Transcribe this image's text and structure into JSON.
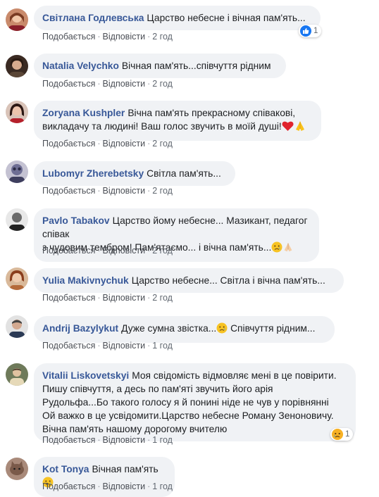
{
  "actions": {
    "like": "Подобається",
    "reply": "Відповісти",
    "sep": "·"
  },
  "comments": [
    {
      "author": "Світлана Годлевська",
      "text": "Царство небесне і вічная пам'ять...",
      "time": "2 год",
      "reaction": {
        "type": "like",
        "count": "1"
      }
    },
    {
      "author": "Natalia Velychko",
      "text": "Вічная пам'ять...співчуття рідним",
      "time": "2 год"
    },
    {
      "author": "Zoryana Kushpler",
      "line1": "Вічна пам'ять прекрасному співакові,",
      "line2": "викладачу та людині! Ваш голос звучить в моїй душі!",
      "time": "2 год",
      "emojis": [
        "red-heart",
        "folded-hands"
      ]
    },
    {
      "author": "Lubomyr Zherebetsky",
      "text": "Світла пам'ять...",
      "time": "2 год"
    },
    {
      "author": "Pavlo Tabakov",
      "line1": "Царство йому небесне... Мазикант, педагог співак",
      "line2": "з чудовим тембром! Пам'ятаємо... і вічна пам'ять...",
      "time": "2 год",
      "emojis": [
        "sad-face",
        "folded-hands"
      ]
    },
    {
      "author": "Yulia Makivnychuk",
      "text": "Царство небесне... Світла і вічна пам'ять...",
      "time": "2 год"
    },
    {
      "author": "Andrij Bazylykut",
      "text_before": "Дуже сумна звістка...",
      "text_after": " Співчуття рідним...",
      "time": "1 год",
      "emojis": [
        "sad-face"
      ]
    },
    {
      "author": "Vitalii Liskovetskyi",
      "line1": "Моя свідомість відмовляє мені в це повірити.",
      "line2": "Пишу співчуття, а десь по пам'яті звучить його арія",
      "line3": "Рудольфа...Бо такого голосу я й понині ніде не чув у порівнянні",
      "line4": "Ой важко в це усвідомити.Царство небесне Роману Зеноновичу.",
      "line5": "Вічна пам'ять нашому дорогому вчителю",
      "time": "1 год",
      "reaction": {
        "type": "sad",
        "count": "1"
      }
    },
    {
      "author": "Kot Tonya",
      "text": "Вічная пам'ять",
      "time": "1 год",
      "emojis": [
        "sad-face"
      ]
    }
  ],
  "colors": {
    "author": "#385898",
    "bubble": "#f0f2f5",
    "meta": "#606770",
    "like": "#1877f2",
    "sad": "#f7b125"
  }
}
